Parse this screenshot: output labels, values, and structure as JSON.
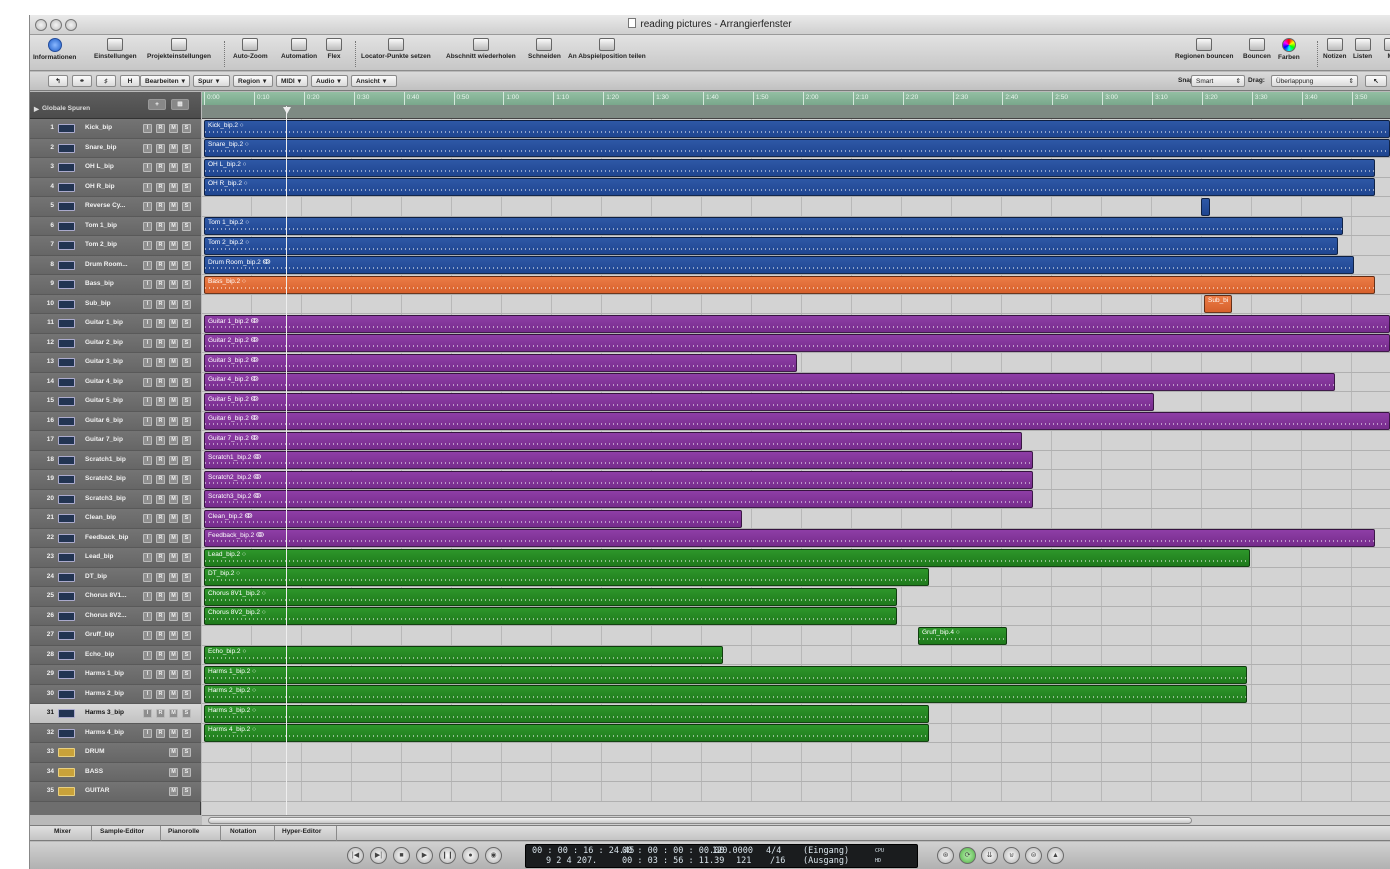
{
  "window": {
    "title": "reading pictures - Arrangierfenster"
  },
  "toolbar": {
    "left": [
      "Informationen",
      "Einstellungen",
      "Projekteinstellungen",
      "Auto-Zoom",
      "Automation",
      "Flex",
      "Locator-Punkte setzen",
      "Abschnitt wiederholen",
      "Schneiden",
      "An Abspielposition teilen"
    ],
    "right": [
      "Regionen bouncen",
      "Bouncen",
      "Farben",
      "Notizen",
      "Listen",
      "Me"
    ]
  },
  "menubar": {
    "menus": [
      "Bearbeiten",
      "Spur",
      "Region",
      "MIDI",
      "Audio",
      "Ansicht"
    ],
    "snap_label": "Snap:",
    "snap_value": "Smart",
    "drag_label": "Drag:",
    "drag_value": "Überlappung"
  },
  "global_tracks_label": "Globale Spuren",
  "ruler": [
    "0:00",
    "0:10",
    "0:20",
    "0:30",
    "0:40",
    "0:50",
    "1:00",
    "1:10",
    "1:20",
    "1:30",
    "1:40",
    "1:50",
    "2:00",
    "2:10",
    "2:20",
    "2:30",
    "2:40",
    "2:50",
    "3:00",
    "3:10",
    "3:20",
    "3:30",
    "3:40",
    "3:50"
  ],
  "tracks": [
    {
      "num": "1",
      "name": "Kick_bip"
    },
    {
      "num": "2",
      "name": "Snare_bip"
    },
    {
      "num": "3",
      "name": "OH L_bip"
    },
    {
      "num": "4",
      "name": "OH R_bip"
    },
    {
      "num": "5",
      "name": "Reverse Cy..."
    },
    {
      "num": "6",
      "name": "Tom 1_bip"
    },
    {
      "num": "7",
      "name": "Tom 2_bip"
    },
    {
      "num": "8",
      "name": "Drum Room..."
    },
    {
      "num": "9",
      "name": "Bass_bip"
    },
    {
      "num": "10",
      "name": "Sub_bip"
    },
    {
      "num": "11",
      "name": "Guitar 1_bip"
    },
    {
      "num": "12",
      "name": "Guitar 2_bip"
    },
    {
      "num": "13",
      "name": "Guitar 3_bip"
    },
    {
      "num": "14",
      "name": "Guitar 4_bip"
    },
    {
      "num": "15",
      "name": "Guitar 5_bip"
    },
    {
      "num": "16",
      "name": "Guitar 6_bip"
    },
    {
      "num": "17",
      "name": "Guitar 7_bip"
    },
    {
      "num": "18",
      "name": "Scratch1_bip"
    },
    {
      "num": "19",
      "name": "Scratch2_bip"
    },
    {
      "num": "20",
      "name": "Scratch3_bip"
    },
    {
      "num": "21",
      "name": "Clean_bip"
    },
    {
      "num": "22",
      "name": "Feedback_bip"
    },
    {
      "num": "23",
      "name": "Lead_bip"
    },
    {
      "num": "24",
      "name": "DT_bip"
    },
    {
      "num": "25",
      "name": "Chorus 8V1..."
    },
    {
      "num": "26",
      "name": "Chorus 8V2..."
    },
    {
      "num": "27",
      "name": "Gruff_bip"
    },
    {
      "num": "28",
      "name": "Echo_bip"
    },
    {
      "num": "29",
      "name": "Harms 1_bip"
    },
    {
      "num": "30",
      "name": "Harms 2_bip"
    },
    {
      "num": "31",
      "name": "Harms 3_bip"
    },
    {
      "num": "32",
      "name": "Harms 4_bip"
    },
    {
      "num": "33",
      "name": "DRUM"
    },
    {
      "num": "34",
      "name": "BASS"
    },
    {
      "num": "35",
      "name": "GUITAR"
    }
  ],
  "regions": [
    {
      "label": "Kick_bip.2 ○",
      "color": "blue"
    },
    {
      "label": "Snare_bip.2 ○",
      "color": "blue"
    },
    {
      "label": "OH L_bip.2 ○",
      "color": "blue"
    },
    {
      "label": "OH R_bip.2 ○",
      "color": "blue"
    },
    {
      "label": "",
      "color": "blue"
    },
    {
      "label": "Tom 1_bip.2 ○",
      "color": "blue"
    },
    {
      "label": "Tom 2_bip.2 ○",
      "color": "blue"
    },
    {
      "label": "Drum Room_bip.2 ↂ",
      "color": "blue"
    },
    {
      "label": "Bass_bip.2 ○",
      "color": "orange"
    },
    {
      "label": "Sub_bi",
      "color": "orange"
    },
    {
      "label": "Guitar 1_bip.2 ↂ",
      "color": "purple"
    },
    {
      "label": "Guitar 2_bip.2 ↂ",
      "color": "purple"
    },
    {
      "label": "Guitar 3_bip.2 ↂ",
      "color": "purple"
    },
    {
      "label": "Guitar 4_bip.2 ↂ",
      "color": "purple"
    },
    {
      "label": "Guitar 5_bip.2 ↂ",
      "color": "purple"
    },
    {
      "label": "Guitar 6_bip.2 ↂ",
      "color": "purple"
    },
    {
      "label": "Guitar 7_bip.2 ↂ",
      "color": "purple"
    },
    {
      "label": "Scratch1_bip.2 ↂ",
      "color": "purple"
    },
    {
      "label": "Scratch2_bip.2 ↂ",
      "color": "purple"
    },
    {
      "label": "Scratch3_bip.2 ↂ",
      "color": "purple"
    },
    {
      "label": "Clean_bip.2 ↂ",
      "color": "purple"
    },
    {
      "label": "Feedback_bip.2 ↂ",
      "color": "purple"
    },
    {
      "label": "Lead_bip.2 ○",
      "color": "green"
    },
    {
      "label": "DT_bip.2 ○",
      "color": "green"
    },
    {
      "label": "Chorus 8V1_bip.2 ○",
      "color": "green"
    },
    {
      "label": "Chorus 8V2_bip.2 ○",
      "color": "green"
    },
    {
      "label": "Gruff_bip.4 ○",
      "color": "green"
    },
    {
      "label": "Echo_bip.2 ○",
      "color": "green"
    },
    {
      "label": "Harms 1_bip.2 ○",
      "color": "green"
    },
    {
      "label": "Harms 2_bip.2 ○",
      "color": "green"
    },
    {
      "label": "Harms 3_bip.2 ○",
      "color": "green"
    },
    {
      "label": "Harms 4_bip.2 ○",
      "color": "green"
    }
  ],
  "bottom_tabs": [
    "Mixer",
    "Sample-Editor",
    "Pianorolle",
    "Notation",
    "Hyper-Editor"
  ],
  "transport": {
    "smpte": "00 : 00 : 16 : 24.45",
    "bars": "9   2   4  207.",
    "locator_start": "00 : 00 : 00 : 00.00",
    "locator_end": "00 : 03 : 56 : 11.39",
    "tempo": "120.0000",
    "tempo2": "121",
    "sig": "4/4",
    "div": "/16",
    "in": "(Eingang)",
    "out": "(Ausgang)",
    "cpu": "CPU",
    "hd": "HD"
  },
  "colors": {
    "blue": "#2a52a0",
    "orange": "#e4703a",
    "purple": "#843599",
    "green": "#268a23",
    "ruler": "#85b497"
  }
}
